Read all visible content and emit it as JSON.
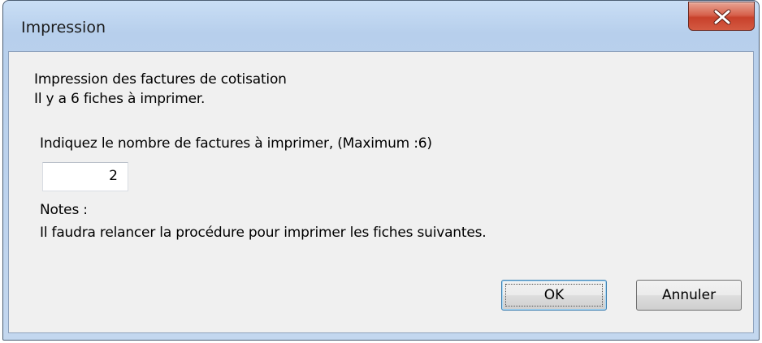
{
  "window": {
    "title": "Impression"
  },
  "dialog": {
    "heading": "Impression des factures de cotisation",
    "count_text": "Il y a 6 fiches à imprimer.",
    "prompt": "Indiquez le nombre de factures à imprimer, (Maximum :6)",
    "quantity_value": "2",
    "notes_label": "Notes :",
    "notes_text": "Il faudra relancer la procédure pour imprimer les fiches suivantes."
  },
  "buttons": {
    "ok_label": "OK",
    "cancel_label": "Annuler"
  },
  "icons": {
    "close": "close-icon"
  },
  "colors": {
    "close_button": "#c8412b",
    "title_bar": "#b7cfec",
    "client_background": "#f0f0f0"
  }
}
